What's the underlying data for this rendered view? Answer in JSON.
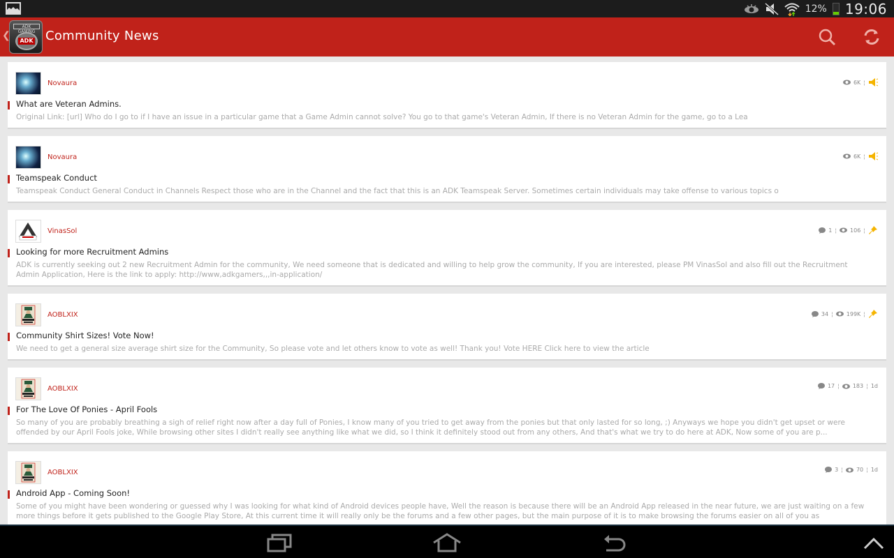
{
  "status_bar": {
    "notification_icon": "gallery-icon",
    "icons": [
      "eye-icon",
      "mute-icon",
      "wifi-icon"
    ],
    "battery_percent": "12%",
    "battery_level": 0.12,
    "time": "19:06"
  },
  "action_bar": {
    "back_glyph": "❮",
    "logo_text_top": "ADK GAMING",
    "logo_text_badge": "ADK",
    "title": "Community News",
    "actions": [
      "search-icon",
      "refresh-icon"
    ]
  },
  "posts": [
    {
      "author": "Novaura",
      "title": "What are Veteran Admins.",
      "excerpt": "Original Link: [url] Who do I go to if I have an issue in a particular game that a Game Admin cannot solve? You go to that game's Veteran Admin, If there is no Veteran Admin for the game, go to a Lea",
      "comments": null,
      "views": "6K",
      "age": null,
      "badge": "announcement-icon"
    },
    {
      "author": "Novaura",
      "title": "Teamspeak Conduct",
      "excerpt": "Teamspeak Conduct General Conduct in Channels Respect those who are in the Channel and the fact that this is an ADK Teamspeak Server. Sometimes certain individuals may take offense to various topics o",
      "comments": null,
      "views": "6K",
      "age": null,
      "badge": "announcement-icon"
    },
    {
      "author": "VinasSol",
      "title": "Looking for more Recruitment Admins",
      "excerpt": "ADK is currently seeking out 2 new Recruitment Admin for the community, We need someone that is dedicated and willing to help grow the community, If you are interested, please PM VinasSol and also fill out the Recruitment Admin Application, Here is the link to apply: http://www,adkgamers,,,in-application/",
      "comments": "1",
      "views": "106",
      "age": null,
      "badge": "pin-icon"
    },
    {
      "author": "AOBLXIX",
      "title": "Community Shirt Sizes!  Vote Now!",
      "excerpt": "We need to get a general size average shirt size for the Community, So please vote and let others know to vote as well! Thank you! Vote HERE Click here to view the article",
      "comments": "34",
      "views": "199K",
      "age": null,
      "badge": "pin-icon"
    },
    {
      "author": "AOBLXIX",
      "title": "For The Love Of Ponies - April Fools",
      "excerpt": "So many of you are probably breathing a sigh of relief right now after a day full of Ponies, I know many of you tried to get away from the ponies but that only lasted for so long, ;) Anyways we hope you didn't get upset or were offended by our April Fools joke, While browsing other sites I didn't really see anything like what we did, so I think it definitely stood out from any others, And that's what we try to do here at ADK, Now some of you are p...",
      "comments": "17",
      "views": "183",
      "age": "1d",
      "badge": null
    },
    {
      "author": "AOBLXIX",
      "title": "Android App - Coming Soon!",
      "excerpt": "Some of you might have been wondering or guessed why I was looking for what kind of Android devices people have, Well the reason is because there will be an Android App released in the near future, we are just waiting on a few more things before it gets published to the Google Play Store, At this current time it will really only be the forums and a few other pages, but the main purpose of it is to make browsing the forums easier on all of you as",
      "comments": "3",
      "views": "70",
      "age": "1d",
      "badge": null
    }
  ],
  "nav_bar": {
    "buttons": [
      "recent-apps-icon",
      "home-icon",
      "back-icon",
      "menu-up-icon"
    ]
  },
  "colors": {
    "accent": "#c0221a",
    "background": "#e8e8e8",
    "badge_yellow": "#f5b400"
  }
}
